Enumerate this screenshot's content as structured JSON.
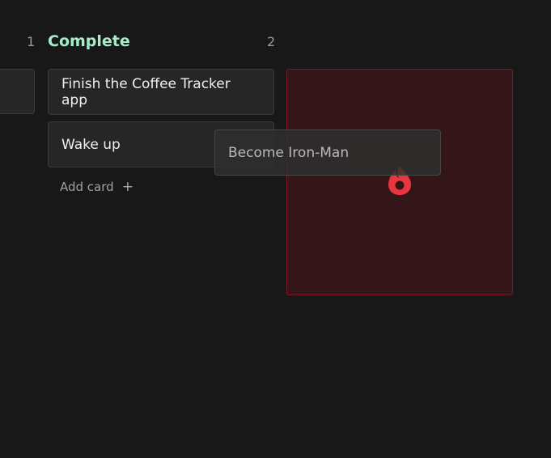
{
  "previous_column": {
    "count": "1"
  },
  "column": {
    "title": "Complete",
    "count": "2",
    "title_color": "#a6ecc8",
    "cards": [
      {
        "label": "Finish the Coffee Tracker app"
      },
      {
        "label": "Wake up"
      }
    ],
    "add_card_label": "Add card",
    "add_icon": "plus-icon"
  },
  "drop_zone": {
    "icon": "fire-icon",
    "accent": "#e8353f",
    "background": "#351618",
    "border": "#7c1a24"
  },
  "dragging_card": {
    "label": "Become Iron-Man"
  }
}
